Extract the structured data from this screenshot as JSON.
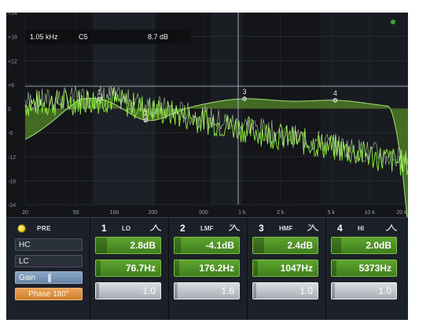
{
  "readout": {
    "freq": "1.05 kHz",
    "note": "C5",
    "gain": "8.7 dB"
  },
  "y_ticks": [
    "+24",
    "+18",
    "+12",
    "+6",
    "0",
    "-6",
    "-12",
    "-18",
    "-24"
  ],
  "x_ticks": [
    "20",
    "50",
    "100",
    "200",
    "500",
    "1 k",
    "2 k",
    "5 k",
    "10 k",
    "20 k"
  ],
  "pre": {
    "label": "PRE",
    "hc": "HC",
    "lc": "LC",
    "gain": "Gain",
    "phase": "Phase 180°",
    "gain_level": 0.45
  },
  "bands": [
    {
      "number": "1",
      "type": "LO",
      "gain": "2.8dB",
      "freq": "76.7Hz",
      "q": "1.0",
      "shape": "bell"
    },
    {
      "number": "2",
      "type": "LMF",
      "gain": "-4.1dB",
      "freq": "176.2Hz",
      "q": "1.6",
      "shape": "bell-variant"
    },
    {
      "number": "3",
      "type": "HMF",
      "gain": "2.4dB",
      "freq": "1047Hz",
      "q": "1.0",
      "shape": "bell-variant"
    },
    {
      "number": "4",
      "type": "HI",
      "gain": "2.0dB",
      "freq": "5373Hz",
      "q": "1.0",
      "shape": "bell"
    }
  ],
  "colors": {
    "eq_fill": "#4e7a26",
    "spectrum": "#8ef23b",
    "accent_green": "#5fa42f",
    "phase_orange": "#e0913f",
    "led_yellow": "#f2d81c"
  }
}
